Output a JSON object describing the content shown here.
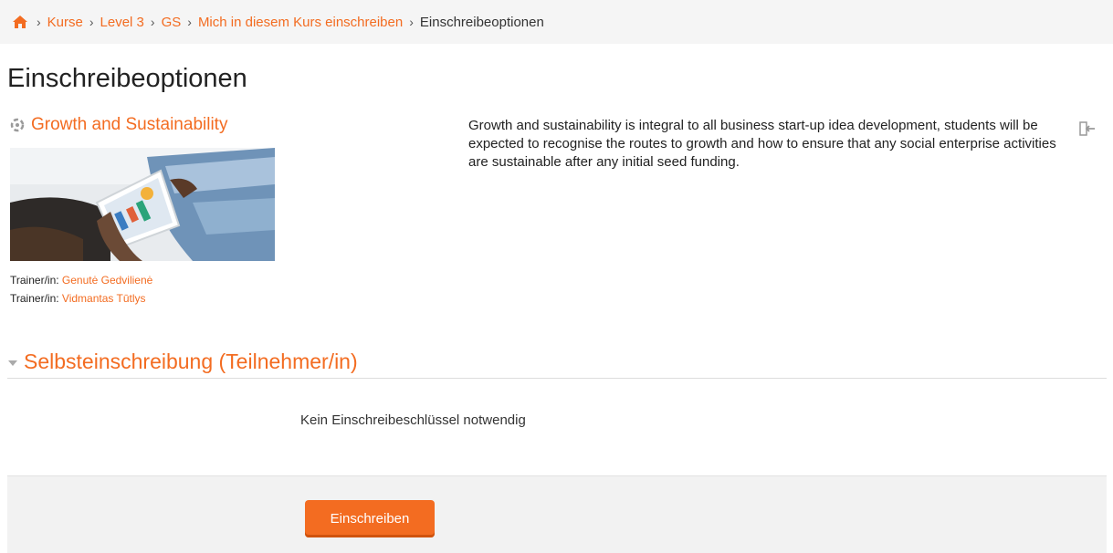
{
  "breadcrumb": {
    "items": [
      "Kurse",
      "Level 3",
      "GS",
      "Mich in diesem Kurs einschreiben"
    ],
    "current": "Einschreibeoptionen"
  },
  "page": {
    "title": "Einschreibeoptionen"
  },
  "course": {
    "name": "Growth and Sustainability",
    "summary": "Growth and sustainability is integral to all business start-up idea development, students will be expected to recognise the routes to growth and how to ensure that any social enterprise activities are sustainable after any initial seed funding.",
    "teachers": [
      {
        "role": "Trainer/in:",
        "name": "Genutė Gedvilienė"
      },
      {
        "role": "Trainer/in:",
        "name": "Vidmantas Tūtlys"
      }
    ]
  },
  "enrolment": {
    "section_title": "Selbsteinschreibung (Teilnehmer/in)",
    "no_key_text": "Kein Einschreibeschlüssel notwendig",
    "button_label": "Einschreiben"
  },
  "colors": {
    "accent": "#f36c21",
    "bar": "#f5f5f5"
  }
}
